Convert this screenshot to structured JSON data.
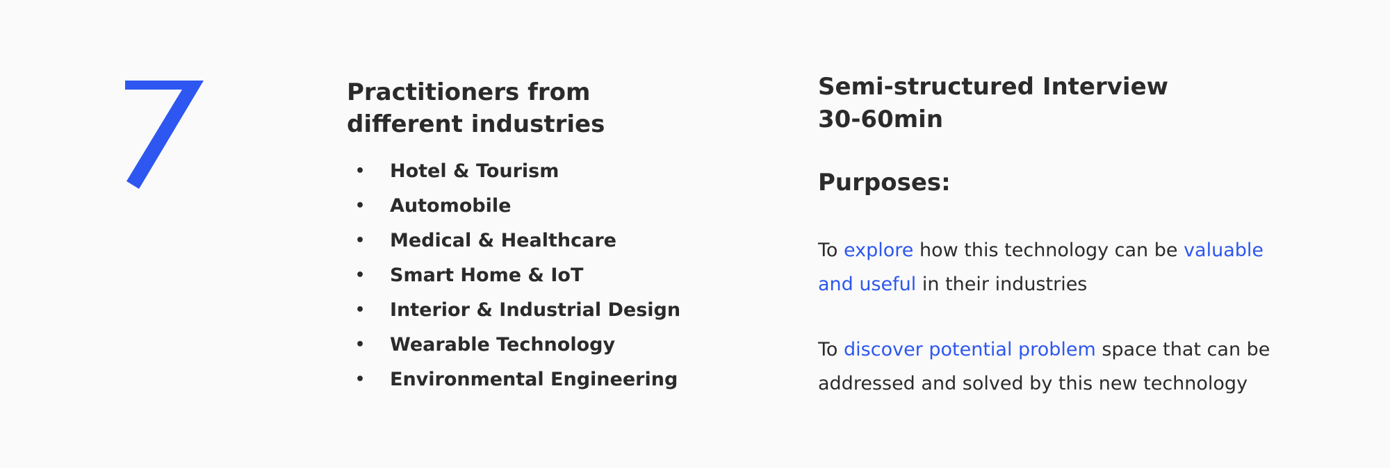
{
  "participants": {
    "count": "7",
    "accent_color": "#2d57f0",
    "title": "Practitioners from different industries",
    "title_line1": "Practitioners from",
    "title_line2": "different industries",
    "bullet": "•",
    "industries": [
      "Hotel & Tourism",
      "Automobile",
      "Medical & Healthcare",
      "Smart Home & IoT",
      "Interior & Industrial Design",
      "Wearable Technology",
      "Environmental Engineering"
    ]
  },
  "method": {
    "title_line1": "Semi-structured Interview",
    "title_line2": "30-60min",
    "purposes_heading": "Purposes:",
    "purposes": [
      {
        "parts": [
          {
            "text": "To ",
            "highlight": false
          },
          {
            "text": "explore",
            "highlight": true
          },
          {
            "text": " how this technology can be ",
            "highlight": false
          },
          {
            "text": "valuable and useful",
            "highlight": true
          },
          {
            "text": " in their industries",
            "highlight": false
          }
        ]
      },
      {
        "parts": [
          {
            "text": "To ",
            "highlight": false
          },
          {
            "text": "discover potential problem",
            "highlight": true
          },
          {
            "text": " space that can be addressed and solved by this new technology",
            "highlight": false
          }
        ]
      }
    ]
  },
  "colors": {
    "background": "#fafafa",
    "text": "#2b2b2b",
    "accent": "#2d57f0"
  }
}
